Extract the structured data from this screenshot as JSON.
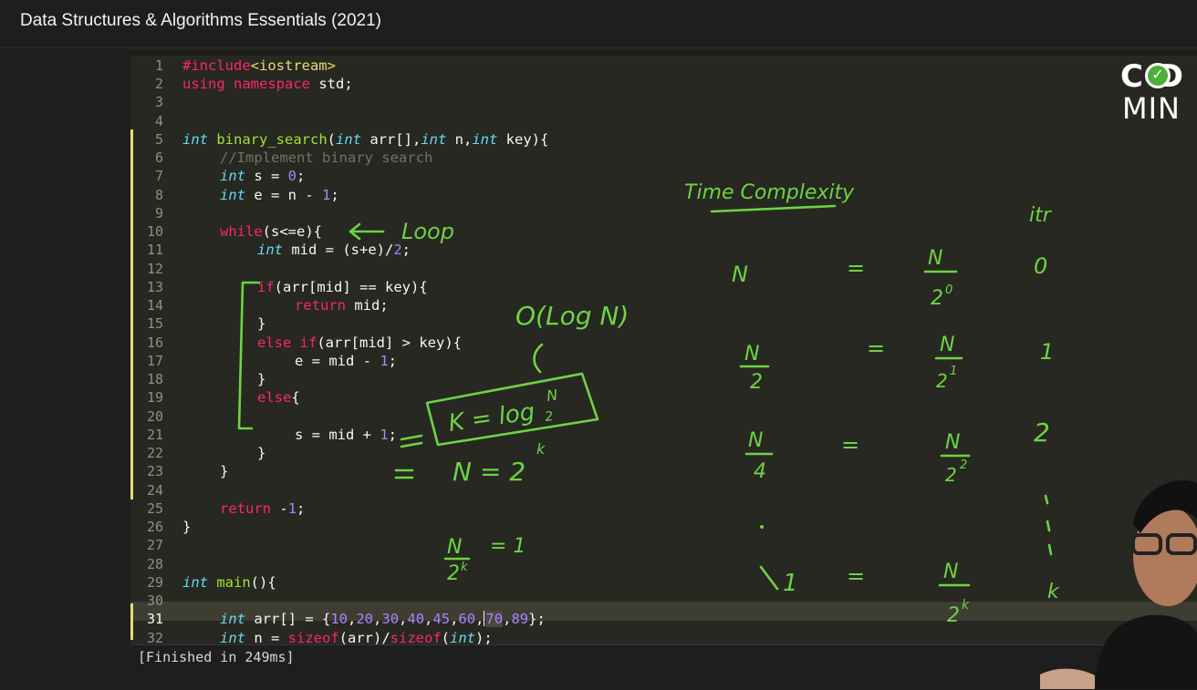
{
  "window": {
    "title": "Data Structures & Algorithms Essentials (2021)"
  },
  "editor": {
    "line_numbers": [
      "1",
      "2",
      "3",
      "4",
      "5",
      "6",
      "7",
      "8",
      "9",
      "10",
      "11",
      "12",
      "13",
      "14",
      "15",
      "16",
      "17",
      "18",
      "19",
      "20",
      "21",
      "22",
      "23",
      "24",
      "25",
      "26",
      "27",
      "28",
      "29",
      "30",
      "31",
      "32"
    ],
    "active_line": "31",
    "code": {
      "l1_include": "#include",
      "l1_header": "<iostream>",
      "l2_using": "using",
      "l2_namespace": "namespace",
      "l2_std": " std;",
      "l5_int": "int",
      "l5_fn": "binary_search",
      "l5_a": "(",
      "l5_int2": "int",
      "l5_b": " arr[],",
      "l5_int3": "int",
      "l5_c": " n,",
      "l5_int4": "int",
      "l5_d": " key){",
      "l6_comment": "//Implement binary search",
      "l7_int": "int",
      "l7_a": " s = ",
      "l7_zero": "0",
      "l7_b": ";",
      "l8_int": "int",
      "l8_a": " e = n - ",
      "l8_one": "1",
      "l8_b": ";",
      "l10_while": "while",
      "l10_a": "(s<=e){",
      "l11_int": "int",
      "l11_a": " mid = (s+e)/",
      "l11_two": "2",
      "l11_b": ";",
      "l13_if": "if",
      "l13_a": "(arr[mid] == key){",
      "l14_return": "return",
      "l14_a": " mid;",
      "l15": "}",
      "l16_else": "else",
      "l16_if": "if",
      "l16_a": "(arr[mid] > key){",
      "l17_a": "e = mid - ",
      "l17_one": "1",
      "l17_b": ";",
      "l18": "}",
      "l19_else": "else",
      "l19_a": "{",
      "l21_a": "s = mid + ",
      "l21_one": "1",
      "l21_b": ";",
      "l22": "}",
      "l23": "}",
      "l25_return": "return",
      "l25_a": " -",
      "l25_one": "1",
      "l25_b": ";",
      "l26": "}",
      "l29_int": "int",
      "l29_fn": "main",
      "l29_a": "(){",
      "l31_int": "int",
      "l31_a": " arr[] = {",
      "l31_n1": "10",
      "l31_n2": "20",
      "l31_n3": "30",
      "l31_n4": "40",
      "l31_n5": "45",
      "l31_n6": "60",
      "l31_n7": "70",
      "l31_n8": "89",
      "l31_comma": ",",
      "l31_b": "};",
      "l32_int": "int",
      "l32_a": " n = ",
      "l32_sizeof": "sizeof",
      "l32_b": "(arr)/",
      "l32_sizeof2": "sizeof",
      "l32_c": "(",
      "l32_int2": "int",
      "l32_d": ");"
    }
  },
  "output_panel": {
    "text": "[Finished in 249ms]"
  },
  "logo": {
    "line1": "C D",
    "line2": "MIN"
  },
  "annotations": {
    "loop": "Loop",
    "time_complexity": "Time Complexity",
    "itr": "itr",
    "big_o": "O(Log N)",
    "k_eq": "K = log",
    "k_sub": "2",
    "k_sup": "N",
    "n_eq": "N = 2",
    "n_eq_sup": "k",
    "n_over_2k": "N",
    "n_over_2k_den": "2",
    "n_over_2k_sup": "k",
    "eq_one": "= 1",
    "rows": [
      {
        "left": "N",
        "num": "N",
        "den": "2",
        "sup": "0",
        "itr": "0"
      },
      {
        "left_num": "N",
        "left_den": "2",
        "num": "N",
        "den": "2",
        "sup": "1",
        "itr": "1"
      },
      {
        "left_num": "N",
        "left_den": "4",
        "num": "N",
        "den": "2",
        "sup": "2",
        "itr": "2"
      },
      {
        "left": "1",
        "num": "N",
        "den": "2",
        "sup": "k",
        "itr": "k"
      }
    ],
    "equals": "="
  },
  "colors": {
    "editor_bg": "#272822",
    "ink": "#6ed344",
    "keyword": "#f92672",
    "type": "#66d9ef",
    "number": "#ae81ff"
  }
}
